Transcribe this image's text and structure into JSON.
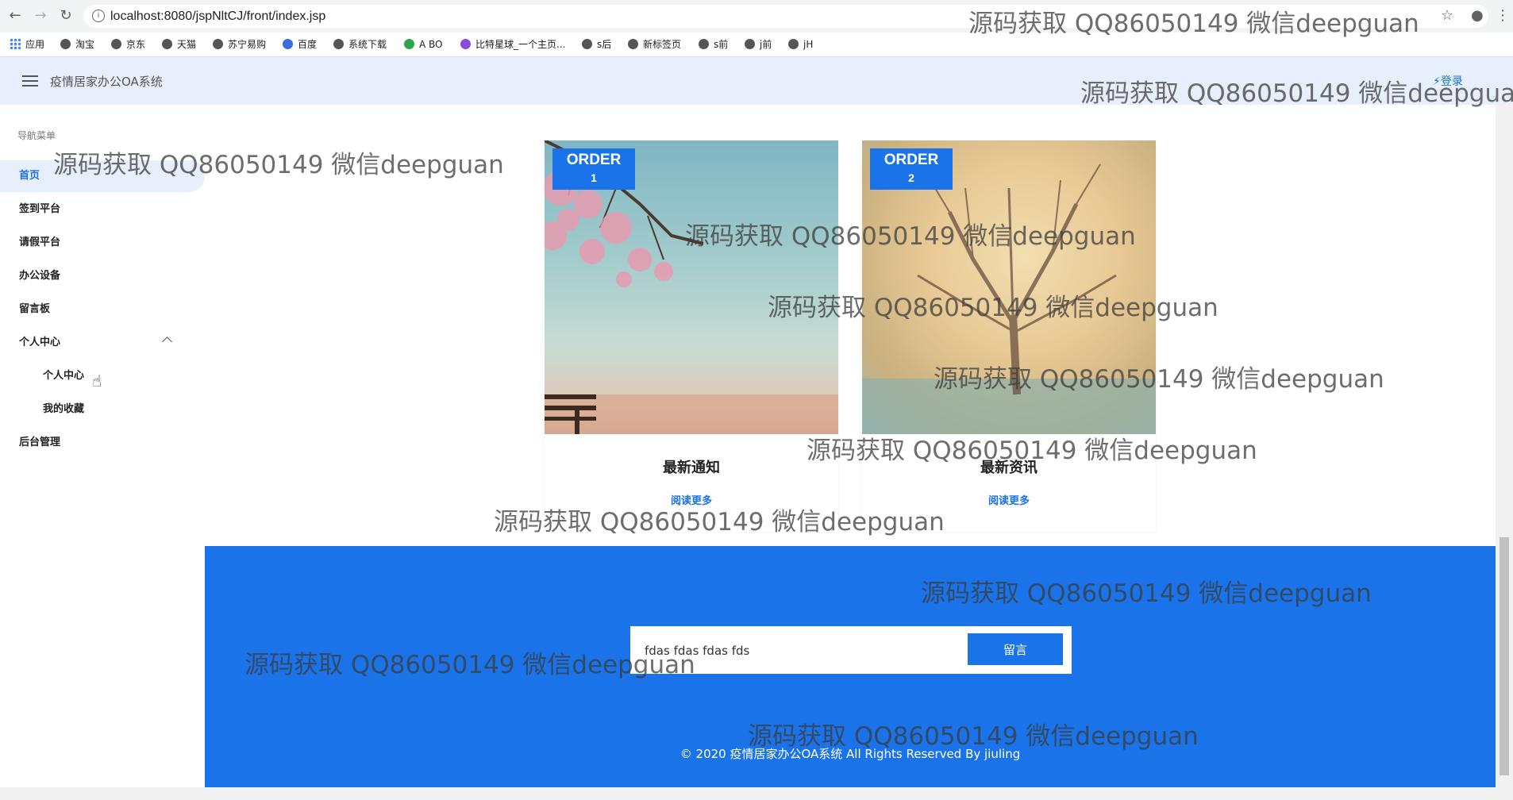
{
  "browser": {
    "url": "localhost:8080/jspNltCJ/front/index.jsp",
    "bookmarks": [
      "应用",
      "淘宝",
      "京东",
      "天猫",
      "苏宁易购",
      "百度",
      "系统下载",
      "A BO",
      "比特星球_一个主页...",
      "s后",
      "新标签页",
      "s前",
      "j前",
      "jH"
    ]
  },
  "header": {
    "title": "疫情居家办公OA系统",
    "login": "⚡登录"
  },
  "sidebar": {
    "title": "导航菜单",
    "items": [
      {
        "label": "首页"
      },
      {
        "label": "签到平台"
      },
      {
        "label": "请假平台"
      },
      {
        "label": "办公设备"
      },
      {
        "label": "留言板"
      },
      {
        "label": "个人中心"
      },
      {
        "label": "个人中心"
      },
      {
        "label": "我的收藏"
      },
      {
        "label": "后台管理"
      }
    ]
  },
  "cards": [
    {
      "order_label": "ORDER",
      "order_num": "1",
      "title": "最新通知",
      "link": "阅读更多"
    },
    {
      "order_label": "ORDER",
      "order_num": "2",
      "title": "最新资讯",
      "link": "阅读更多"
    }
  ],
  "footer": {
    "message_value": "fdas fdas fdas fds",
    "submit": "留言",
    "copyright": "© 2020 疫情居家办公OA系统 All Rights Reserved By jiuling"
  },
  "watermark": "源码获取 QQ86050149 微信deepguan",
  "colors": {
    "primary": "#1a73e8",
    "header_bg": "#e7effc"
  }
}
